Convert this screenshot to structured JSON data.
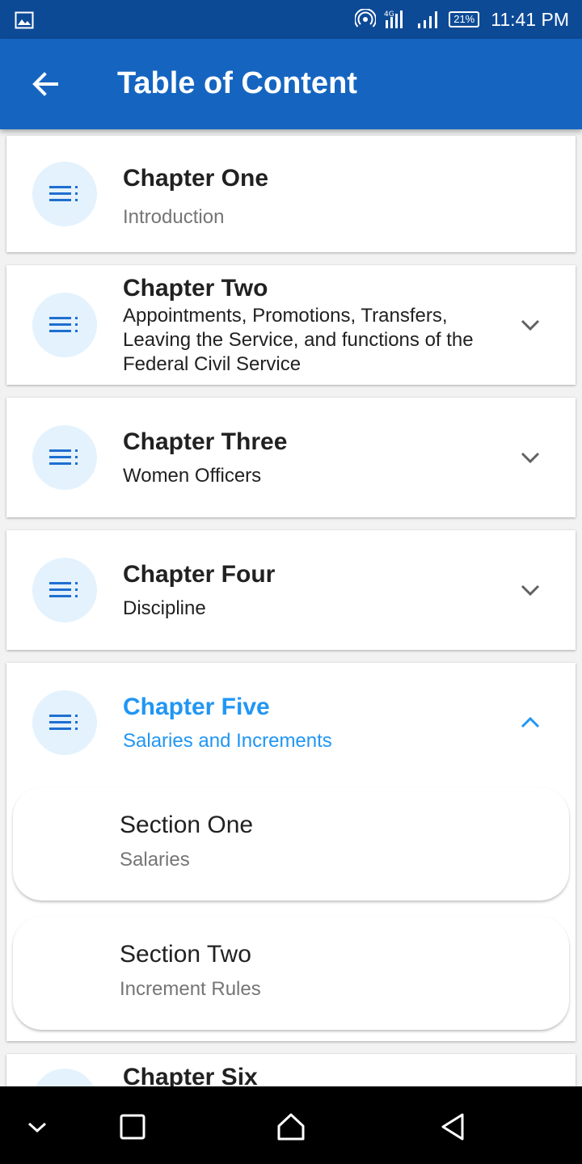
{
  "status_bar": {
    "time": "11:41 PM",
    "battery": "21%",
    "network": "4G"
  },
  "app_bar": {
    "title": "Table of Content",
    "back_icon": "arrow-back-icon"
  },
  "chapters": [
    {
      "title": "Chapter One",
      "subtitle": "Introduction",
      "expandable": false
    },
    {
      "title": "Chapter Two",
      "subtitle": "Appointments, Promotions, Transfers, Leaving the Service, and functions of the Federal Civil Service",
      "expandable": true,
      "expanded": false
    },
    {
      "title": "Chapter Three",
      "subtitle": "Women Officers",
      "expandable": true,
      "expanded": false
    },
    {
      "title": "Chapter Four",
      "subtitle": "Discipline",
      "expandable": true,
      "expanded": false
    },
    {
      "title": "Chapter Five",
      "subtitle": "Salaries and Increments",
      "expandable": true,
      "expanded": true,
      "sections": [
        {
          "title": "Section One",
          "subtitle": "Salaries"
        },
        {
          "title": "Section Two",
          "subtitle": "Increment Rules"
        }
      ]
    },
    {
      "title": "Chapter Six",
      "subtitle": "",
      "expandable": true,
      "expanded": false
    }
  ],
  "colors": {
    "status_bar": "#0d4a96",
    "app_bar": "#1565c0",
    "accent": "#2196f3",
    "icon_circle": "#e3f2fd",
    "list_icon": "#1e6fd0"
  },
  "nav_icons": [
    "chevron-down-icon",
    "recents-square-icon",
    "home-icon",
    "back-triangle-icon"
  ]
}
